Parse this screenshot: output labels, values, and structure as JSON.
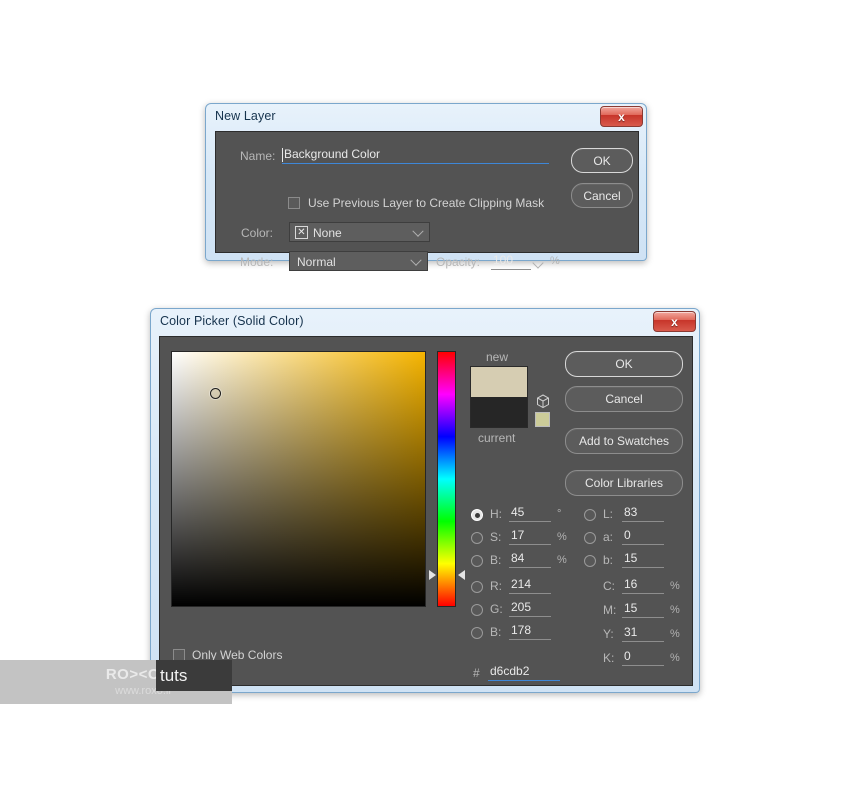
{
  "new_layer_dialog": {
    "title": "New Layer",
    "close_label": "x",
    "name_label": "Name:",
    "name_value": "Background Color",
    "clipping_mask_label": "Use Previous Layer to Create Clipping Mask",
    "clipping_mask_checked": false,
    "color_label": "Color:",
    "color_value": "None",
    "color_swatch_glyph": "✕",
    "mode_label": "Mode:",
    "mode_value": "Normal",
    "opacity_label": "Opacity:",
    "opacity_value": "100",
    "opacity_unit": "%",
    "ok_label": "OK",
    "cancel_label": "Cancel"
  },
  "color_picker": {
    "title": "Color Picker (Solid Color)",
    "close_label": "x",
    "ok_label": "OK",
    "cancel_label": "Cancel",
    "add_to_swatches_label": "Add to Swatches",
    "color_libraries_label": "Color Libraries",
    "new_label": "new",
    "current_label": "current",
    "new_color": "#d6cdb2",
    "current_color": "#262626",
    "websafe_color": "#cccc99",
    "only_web_colors_label": "Only Web Colors",
    "only_web_colors_checked": false,
    "hex_symbol": "#",
    "hex_value": "d6cdb2",
    "selected_model": "H",
    "hsb": [
      {
        "key": "H",
        "label": "H:",
        "value": "45",
        "unit": "°",
        "selected": true
      },
      {
        "key": "S",
        "label": "S:",
        "value": "17",
        "unit": "%",
        "selected": false
      },
      {
        "key": "B",
        "label": "B:",
        "value": "84",
        "unit": "%",
        "selected": false
      }
    ],
    "lab": [
      {
        "key": "L",
        "label": "L:",
        "value": "83",
        "unit": "",
        "selected": false
      },
      {
        "key": "a",
        "label": "a:",
        "value": "0",
        "unit": "",
        "selected": false
      },
      {
        "key": "b",
        "label": "b:",
        "value": "15",
        "unit": "",
        "selected": false
      }
    ],
    "rgb": [
      {
        "key": "R",
        "label": "R:",
        "value": "214",
        "unit": "",
        "selected": false
      },
      {
        "key": "G",
        "label": "G:",
        "value": "205",
        "unit": "",
        "selected": false
      },
      {
        "key": "B",
        "label": "B:",
        "value": "178",
        "unit": "",
        "selected": false
      }
    ],
    "cmyk": [
      {
        "key": "C",
        "label": "C:",
        "value": "16",
        "unit": "%"
      },
      {
        "key": "M",
        "label": "M:",
        "value": "15",
        "unit": "%"
      },
      {
        "key": "Y",
        "label": "Y:",
        "value": "31",
        "unit": "%"
      },
      {
        "key": "K",
        "label": "K:",
        "value": "0",
        "unit": "%"
      }
    ],
    "field_hue_color": "#f5b400",
    "marker_left_pct": 17,
    "marker_top_pct": 16
  },
  "watermark": {
    "logo": "RO><O",
    "tuts": "tuts",
    "url": "www.roxo.ir"
  }
}
